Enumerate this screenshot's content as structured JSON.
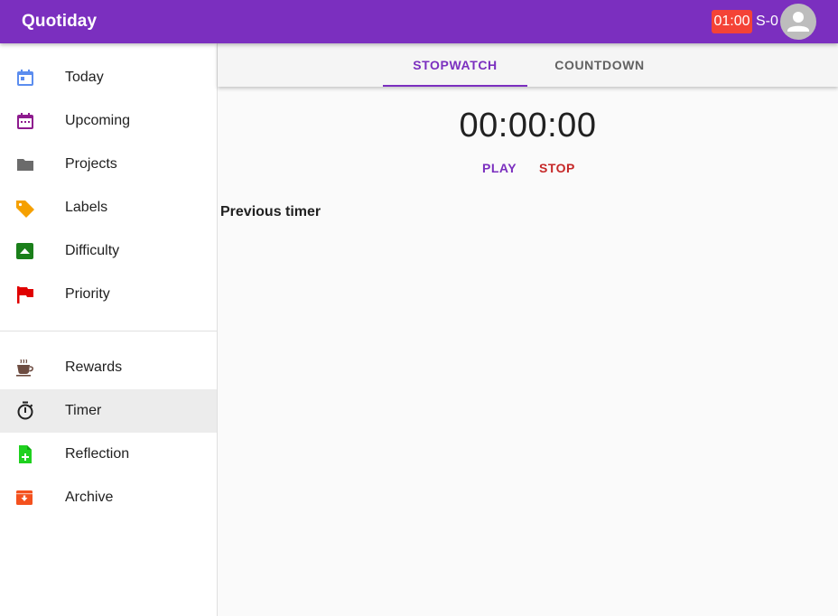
{
  "app": {
    "title": "Quotiday"
  },
  "header": {
    "timer_badge": "01:00",
    "streak": "S-0",
    "colors": {
      "bar": "#7b2fbf",
      "badge": "#f44336"
    }
  },
  "sidebar": {
    "items": [
      {
        "label": "Today",
        "icon": "calendar-today-icon"
      },
      {
        "label": "Upcoming",
        "icon": "calendar-upcoming-icon"
      },
      {
        "label": "Projects",
        "icon": "folder-icon"
      },
      {
        "label": "Labels",
        "icon": "label-tag-icon"
      },
      {
        "label": "Difficulty",
        "icon": "difficulty-up-icon"
      },
      {
        "label": "Priority",
        "icon": "flag-icon"
      },
      {
        "label": "Rewards",
        "icon": "coffee-cup-icon"
      },
      {
        "label": "Timer",
        "icon": "stopwatch-icon",
        "active": true
      },
      {
        "label": "Reflection",
        "icon": "note-add-icon"
      },
      {
        "label": "Archive",
        "icon": "archive-icon"
      }
    ]
  },
  "main": {
    "tabs": [
      {
        "label": "STOPWATCH",
        "selected": true
      },
      {
        "label": "COUNTDOWN",
        "selected": false
      }
    ],
    "clock": "00:00:00",
    "play_label": "PLAY",
    "stop_label": "STOP",
    "previous_heading": "Previous timer"
  }
}
